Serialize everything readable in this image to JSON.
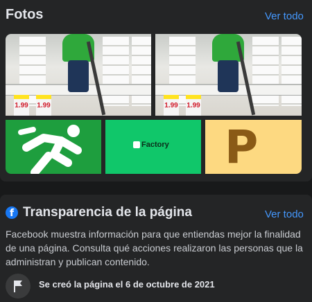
{
  "photos": {
    "title": "Fotos",
    "see_all": "Ver todo",
    "items": [
      {
        "icon": "store-aisle-photo",
        "price_tags": [
          "1.99",
          "1.99"
        ]
      },
      {
        "icon": "store-aisle-photo",
        "price_tags": [
          "1.99",
          "1.99"
        ]
      },
      {
        "icon": "running-person-logo"
      },
      {
        "icon": "factory-logo",
        "text": "Factory"
      },
      {
        "icon": "letter-p-logo",
        "text": "P"
      }
    ]
  },
  "transparency": {
    "title": "Transparencia de la página",
    "see_all": "Ver todo",
    "description": "Facebook muestra información para que entiendas mejor la finalidad de una página. Consulta qué acciones realizaron las personas que la administran y publican contenido.",
    "created": "Se creó la página el 6 de octubre de 2021",
    "icons": {
      "header": "facebook-icon",
      "created": "flag-icon"
    }
  },
  "colors": {
    "accent_link": "#4599ff",
    "card_bg": "#242526",
    "page_bg": "#18191a"
  }
}
